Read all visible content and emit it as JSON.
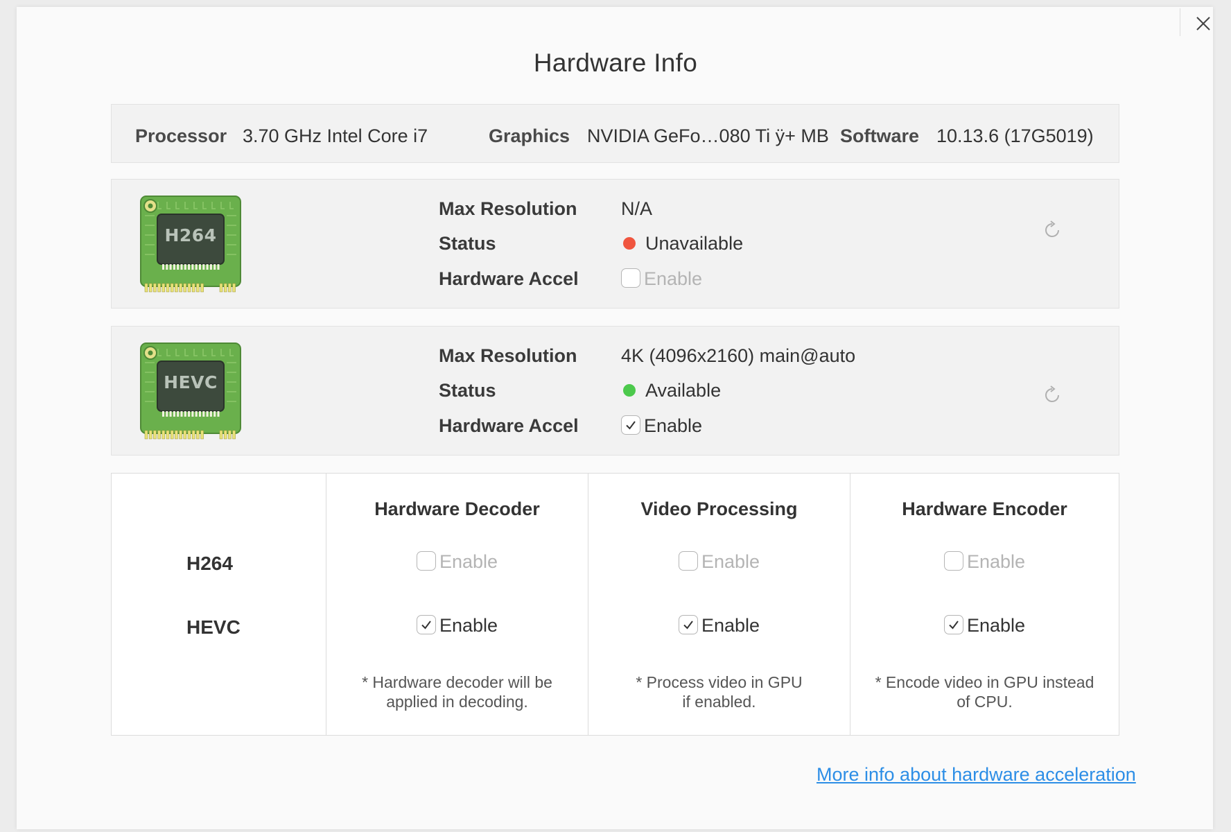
{
  "dialog": {
    "title": "Hardware Info"
  },
  "system": {
    "processor_label": "Processor",
    "processor_value": "3.70 GHz Intel Core i7",
    "graphics_label": "Graphics",
    "graphics_value": "NVIDIA GeFo…080 Ti ÿ+ MB",
    "software_label": "Software",
    "software_value": "10.13.6 (17G5019)"
  },
  "codecs": [
    {
      "chip_label": "H264",
      "max_resolution_label": "Max Resolution",
      "max_resolution_value": "N/A",
      "status_label": "Status",
      "status_value": "Unavailable",
      "status_color": "#f0553f",
      "hw_accel_label": "Hardware Accel",
      "hw_accel_checkbox_label": "Enable",
      "hw_accel_checked": false,
      "refresh_icon": "refresh-icon"
    },
    {
      "chip_label": "HEVC",
      "max_resolution_label": "Max Resolution",
      "max_resolution_value": "4K (4096x2160) main@auto",
      "status_label": "Status",
      "status_value": "Available",
      "status_color": "#4cc94c",
      "hw_accel_label": "Hardware Accel",
      "hw_accel_checkbox_label": "Enable",
      "hw_accel_checked": true,
      "refresh_icon": "refresh-icon"
    }
  ],
  "matrix": {
    "columns": [
      "Hardware Decoder",
      "Video Processing",
      "Hardware Encoder"
    ],
    "rows": [
      {
        "label": "H264",
        "cells": [
          {
            "label": "Enable",
            "checked": false
          },
          {
            "label": "Enable",
            "checked": false
          },
          {
            "label": "Enable",
            "checked": false
          }
        ]
      },
      {
        "label": "HEVC",
        "cells": [
          {
            "label": "Enable",
            "checked": true
          },
          {
            "label": "Enable",
            "checked": true
          },
          {
            "label": "Enable",
            "checked": true
          }
        ]
      }
    ],
    "notes": [
      {
        "line1": "* Hardware decoder will be",
        "line2": "applied in decoding."
      },
      {
        "line1": "* Process video in GPU",
        "line2": "if enabled."
      },
      {
        "line1": "* Encode video in GPU instead",
        "line2": "of CPU."
      }
    ]
  },
  "footer": {
    "link_text": "More info about hardware acceleration"
  },
  "colors": {
    "link": "#2d8ee6",
    "chip_green": "#6ab04c",
    "chip_dark": "#3d4a3d"
  }
}
